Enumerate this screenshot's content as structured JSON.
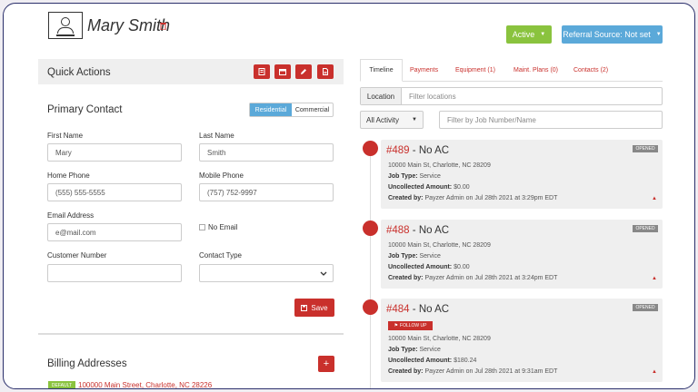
{
  "header": {
    "customer_name": "Mary Smith",
    "status_label": "Active",
    "referral_label": "Referral Source: Not set"
  },
  "quick_actions": {
    "title": "Quick Actions"
  },
  "primary_contact": {
    "title": "Primary Contact",
    "type_options": [
      "Residential",
      "Commercial"
    ],
    "first_name_label": "First Name",
    "first_name_value": "Mary",
    "last_name_label": "Last Name",
    "last_name_value": "Smith",
    "home_phone_label": "Home Phone",
    "home_phone_value": "(555) 555-5555",
    "mobile_phone_label": "Mobile Phone",
    "mobile_phone_value": "(757) 752-9997",
    "email_label": "Email Address",
    "email_placeholder": "e@mail.com",
    "no_email_label": "No Email",
    "customer_number_label": "Customer Number",
    "contact_type_label": "Contact Type",
    "save_label": "Save"
  },
  "billing": {
    "title": "Billing Addresses",
    "default_badge": "DEFAULT",
    "address": "100000 Main Street, Charlotte, NC 28226"
  },
  "tabs": [
    {
      "label": "Timeline"
    },
    {
      "label": "Payments"
    },
    {
      "label": "Equipment (1)"
    },
    {
      "label": "Maint. Plans (0)"
    },
    {
      "label": "Contacts (2)"
    }
  ],
  "filters": {
    "location_label": "Location",
    "location_placeholder": "Filter locations",
    "activity_label": "All Activity",
    "job_placeholder": "Filter by Job Number/Name"
  },
  "timeline": [
    {
      "number": "#489",
      "title": "- No AC",
      "status": "OPENED",
      "address": "10000 Main St, Charlotte, NC 28209",
      "job_type_label": "Job Type:",
      "job_type": "Service",
      "uncollected_label": "Uncollected Amount:",
      "uncollected": "$0.00",
      "created_label": "Created by:",
      "created": "Payzer Admin on Jul 28th 2021 at 3:29pm EDT"
    },
    {
      "number": "#488",
      "title": "- No AC",
      "status": "OPENED",
      "address": "10000 Main St, Charlotte, NC 28209",
      "job_type_label": "Job Type:",
      "job_type": "Service",
      "uncollected_label": "Uncollected Amount:",
      "uncollected": "$0.00",
      "created_label": "Created by:",
      "created": "Payzer Admin on Jul 28th 2021 at 3:24pm EDT"
    },
    {
      "number": "#484",
      "title": "- No AC",
      "status": "OPENED",
      "badge": "FOLLOW UP",
      "address": "10000 Main St, Charlotte, NC 28209",
      "job_type_label": "Job Type:",
      "job_type": "Service",
      "uncollected_label": "Uncollected Amount:",
      "uncollected": "$180.24",
      "created_label": "Created by:",
      "created": "Payzer Admin on Jul 28th 2021 at 9:31am EDT"
    }
  ],
  "colors": {
    "accent_red": "#c9302c",
    "active_green": "#8ac33e",
    "referral_blue": "#5ba9d9"
  }
}
